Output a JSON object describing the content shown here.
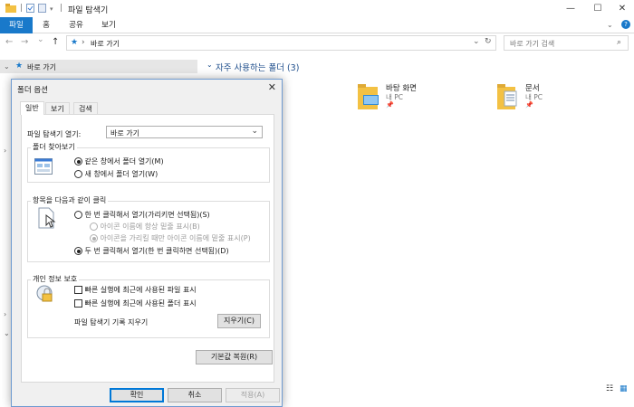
{
  "window": {
    "title": "파일 탐색기",
    "minimize": "—",
    "maximize": "☐",
    "close": "✕"
  },
  "ribbon": {
    "tabs": [
      "파일",
      "홈",
      "공유",
      "보기"
    ],
    "active_tab": "파일",
    "accent": "#1979ca"
  },
  "address": {
    "back": "←",
    "forward": "→",
    "recent": "⌄",
    "up": "↑",
    "separator": "›",
    "path": "바로 가기",
    "search_placeholder": "바로 가기 검색"
  },
  "nav_pane": {
    "quick_access": "바로 가기"
  },
  "content": {
    "section_header": "자주 사용하는 폴더 (3)",
    "folders": [
      {
        "name": "바탕 화면",
        "location": "내 PC"
      },
      {
        "name": "문서",
        "location": "내 PC"
      }
    ],
    "folder_color": "#f3c143",
    "accent_text": "#1e4e8c"
  },
  "dialog": {
    "title": "폴더 옵션",
    "close": "✕",
    "tabs": [
      "일반",
      "보기",
      "검색"
    ],
    "active_tab": "일반",
    "open_explorer_label": "파일 탐색기 열기:",
    "open_explorer_value": "바로 가기",
    "browse_group": {
      "label": "폴더 찾아보기",
      "options": [
        "같은 창에서 폴더 열기(M)",
        "새 창에서 폴더 열기(W)"
      ],
      "selected": 0
    },
    "click_group": {
      "label": "항목을 다음과 같이 클릭",
      "single_click": "한 번 클릭해서 열기(가리키면 선택됨)(S)",
      "underline_always": "아이콘 이름에 항상 밑줄 표시(B)",
      "underline_hover": "아이콘을 가리킬 때만 아이콘 이름에 밑줄 표시(P)",
      "double_click": "두 번 클릭해서 열기(한 번 클릭하면 선택됨)(D)"
    },
    "privacy_group": {
      "label": "개인 정보 보호",
      "recent_files": "빠른 실행에 최근에 사용된 파일 표시",
      "recent_folders": "빠른 실행에 최근에 사용된 폴더 표시",
      "clear_label": "파일 탐색기 기록 지우기",
      "clear_button": "지우기(C)"
    },
    "restore_button": "기본값 복원(R)",
    "ok": "확인",
    "cancel": "취소",
    "apply": "적용(A)"
  }
}
